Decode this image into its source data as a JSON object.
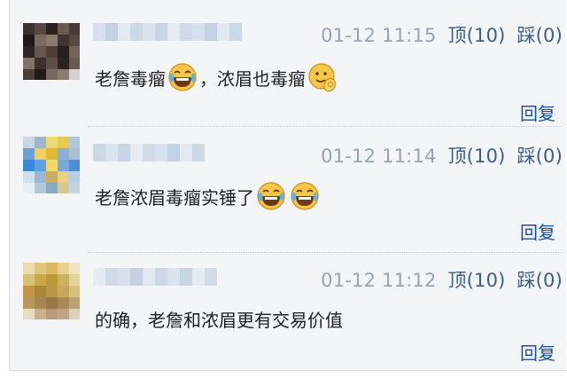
{
  "comments": [
    {
      "timestamp": "01-12 11:15",
      "upvote": "顶(10)",
      "downvote": "踩(0)",
      "text_parts": [
        "老詹毒瘤",
        "，浓眉也毒瘤"
      ],
      "emojis": [
        "laugh-cry-emoji",
        "ok-hand-emoji"
      ],
      "reply_label": "回复"
    },
    {
      "timestamp": "01-12 11:14",
      "upvote": "顶(10)",
      "downvote": "踩(0)",
      "text_parts": [
        "老詹浓眉毒瘤实锤了"
      ],
      "emojis": [
        "laugh-cry-emoji",
        "laugh-cry-emoji"
      ],
      "reply_label": "回复"
    },
    {
      "timestamp": "01-12 11:12",
      "upvote": "顶(10)",
      "downvote": "踩(0)",
      "text_parts": [
        "的确，老詹和浓眉更有交易价值"
      ],
      "emojis": [],
      "reply_label": "回复"
    }
  ],
  "colors": {
    "panel_bg": "#f4f5f7",
    "meta_gray": "#97a4b3",
    "action_blue": "#3c5e86",
    "reply_blue": "#1a4ea3",
    "emoji_yellow": "#f7c64a"
  }
}
